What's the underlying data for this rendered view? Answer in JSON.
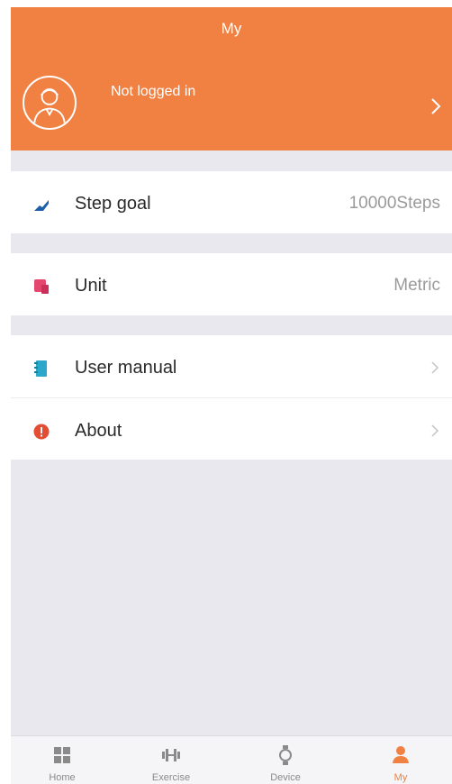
{
  "header": {
    "title": "My",
    "profile": {
      "status_text": "Not logged in",
      "avatar_icon": "user-avatar-icon",
      "chevron_icon": "chevron-right-icon"
    }
  },
  "settings": {
    "groups": [
      {
        "items": [
          {
            "label": "Step goal",
            "value": "10000Steps",
            "icon": "shoe-icon",
            "icon_color": "#1f5fa8"
          }
        ]
      },
      {
        "items": [
          {
            "label": "Unit",
            "value": "Metric",
            "icon": "unit-icon",
            "icon_color": "#e5476f"
          }
        ]
      },
      {
        "items": [
          {
            "label": "User manual",
            "icon": "manual-icon",
            "icon_color": "#2aa7c9"
          },
          {
            "label": "About",
            "icon": "info-icon",
            "icon_color": "#e24d33"
          }
        ]
      }
    ]
  },
  "tabbar": {
    "tabs": [
      {
        "label": "Home",
        "icon": "grid-icon",
        "active": false
      },
      {
        "label": "Exercise",
        "icon": "dumbbell-icon",
        "active": false
      },
      {
        "label": "Device",
        "icon": "watch-icon",
        "active": false
      },
      {
        "label": "My",
        "icon": "person-icon",
        "active": true
      }
    ]
  },
  "colors": {
    "accent": "#f08143",
    "background": "#e9e8ee",
    "inactive_tab": "#8a8a8a"
  }
}
